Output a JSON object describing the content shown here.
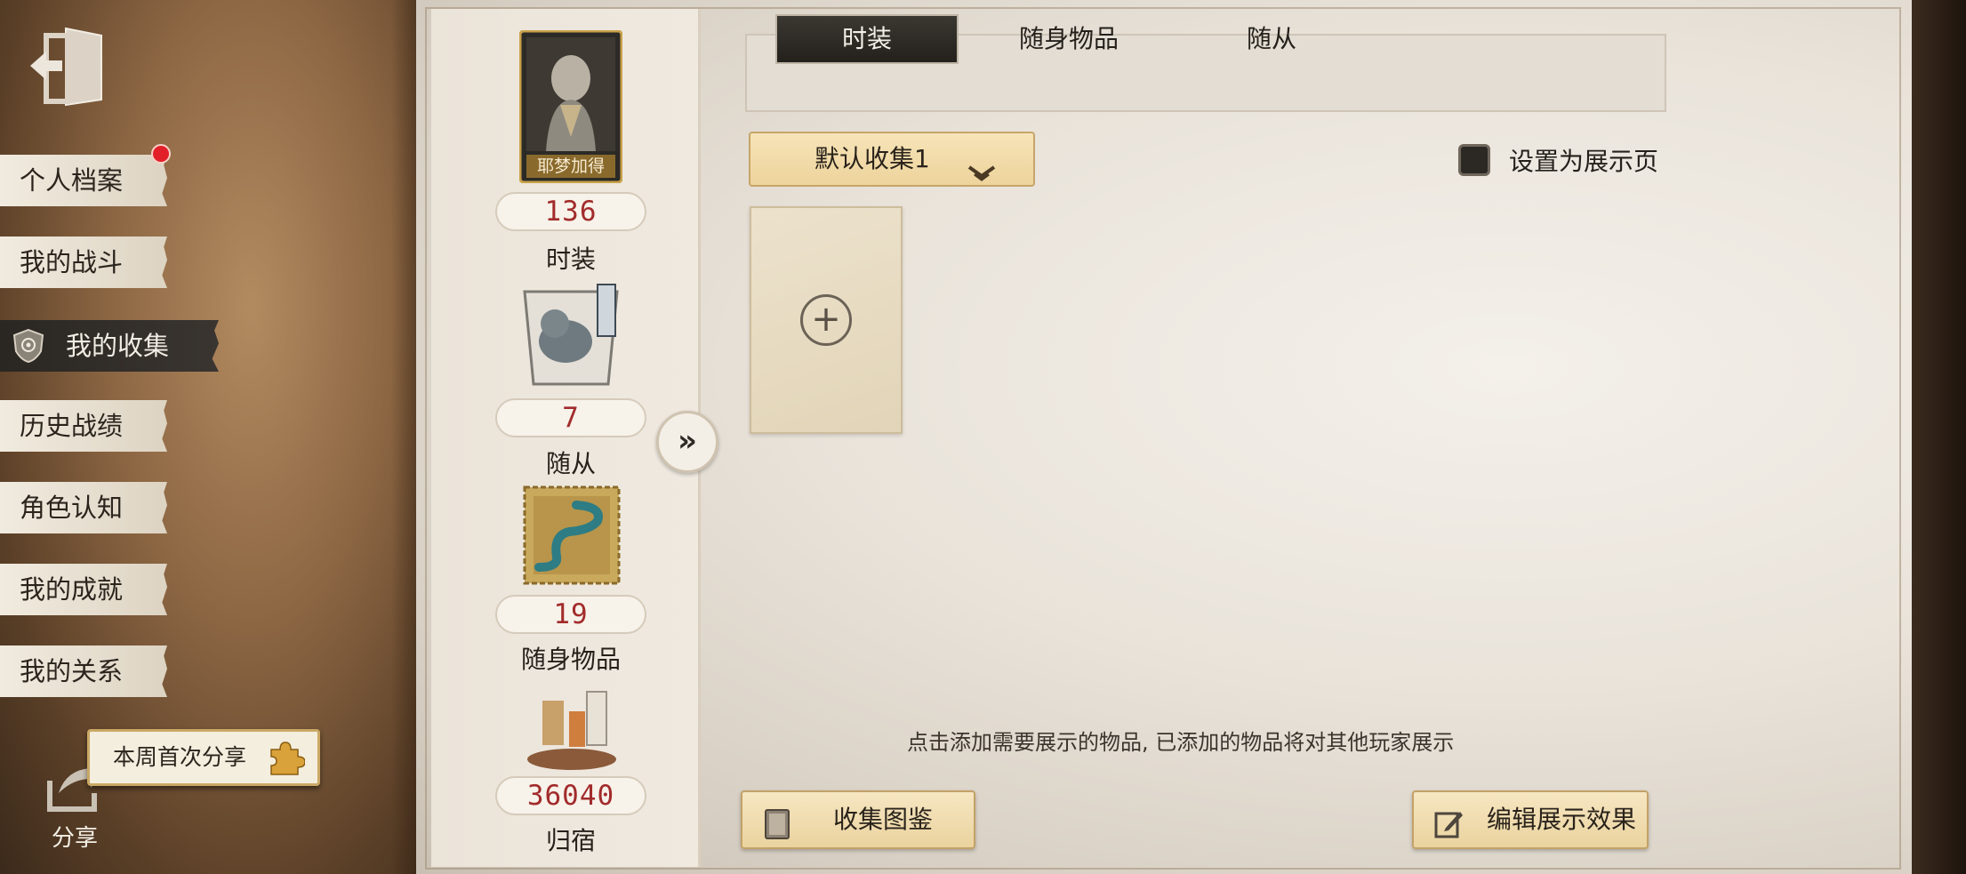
{
  "sidebar": {
    "items": [
      {
        "label": "个人档案",
        "active": false
      },
      {
        "label": "我的战斗",
        "active": false
      },
      {
        "label": "我的收集",
        "active": true
      },
      {
        "label": "历史战绩",
        "active": false
      },
      {
        "label": "角色认知",
        "active": false
      },
      {
        "label": "我的成就",
        "active": false
      },
      {
        "label": "我的关系",
        "active": false
      }
    ],
    "share_tip": "本周首次分享",
    "share_label": "分享"
  },
  "stats": [
    {
      "value": "136",
      "label": "时装",
      "thumb_caption": "耶梦加得"
    },
    {
      "value": "7",
      "label": "随从"
    },
    {
      "value": "19",
      "label": "随身物品"
    },
    {
      "value": "36040",
      "label": "归宿"
    }
  ],
  "tabs": [
    {
      "label": "时装",
      "active": true
    },
    {
      "label": "随身物品",
      "active": false
    },
    {
      "label": "随从",
      "active": false
    }
  ],
  "collection_select": {
    "value": "默认收集1"
  },
  "showcase_checkbox": {
    "label": "设置为展示页",
    "checked": false
  },
  "hint": "点击添加需要展示的物品, 已添加的物品将对其他玩家展示",
  "footer": {
    "gallery_button": "收集图鉴",
    "edit_button": "编辑展示效果"
  },
  "colors": {
    "accent_red": "#a22b2b",
    "active_tab": "#2a2622",
    "gold_button": "#eed39c"
  }
}
